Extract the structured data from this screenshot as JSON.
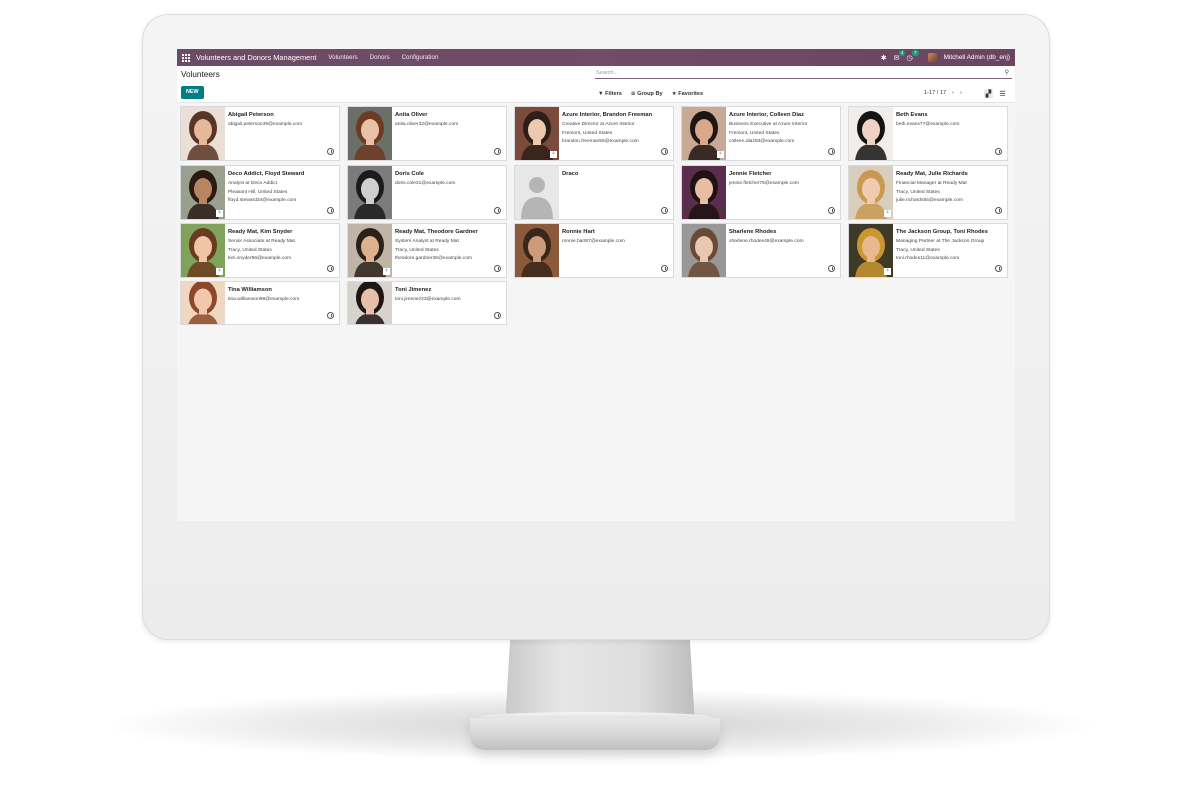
{
  "navbar": {
    "app_title": "Volunteers and Donors Management",
    "menus": [
      "Volunteers",
      "Donors",
      "Configuration"
    ],
    "messages_badge": "4",
    "activities_badge": "7",
    "user": "Mitchell Admin (db_enj)"
  },
  "control_panel": {
    "breadcrumb": "Volunteers",
    "search_placeholder": "Search...",
    "new_label": "NEW",
    "filters_label": "Filters",
    "groupby_label": "Group By",
    "favorites_label": "Favorites",
    "pager": "1-17 / 17"
  },
  "cards": [
    {
      "name": "Abigail Peterson",
      "lines": [
        "abigail.peterson39@example.com"
      ],
      "photo": "woman-curly-brown",
      "company_icon": false
    },
    {
      "name": "Anita Oliver",
      "lines": [
        "anita.oliver32@example.com"
      ],
      "photo": "woman-brown",
      "company_icon": false
    },
    {
      "name": "Azure Interior, Brandon Freeman",
      "lines": [
        "Creative Director at Azure Interior",
        "Fremont, United States",
        "brandon.freeman55@example.com"
      ],
      "photo": "man-young",
      "company_icon": true
    },
    {
      "name": "Azure Interior, Colleen Diaz",
      "lines": [
        "Business Executive at Azure Interior",
        "Fremont, United States",
        "colleen.diaz83@example.com"
      ],
      "photo": "woman-dark",
      "company_icon": true
    },
    {
      "name": "Beth Evans",
      "lines": [
        "beth.evans77@example.com"
      ],
      "photo": "woman-hat",
      "company_icon": false
    },
    {
      "name": "Deco Addict, Floyd Steward",
      "lines": [
        "Analyst at Deco Addict",
        "Pleasant Hill, United States",
        "floyd.steward34@example.com"
      ],
      "photo": "man-smile",
      "company_icon": true
    },
    {
      "name": "Doris Cole",
      "lines": [
        "doris.cole31@example.com"
      ],
      "photo": "woman-bw",
      "company_icon": false
    },
    {
      "name": "Draco",
      "lines": [],
      "photo": "placeholder",
      "company_icon": false
    },
    {
      "name": "Jennie Fletcher",
      "lines": [
        "jennie.fletcher76@example.com"
      ],
      "photo": "woman-dark-hair",
      "company_icon": false
    },
    {
      "name": "Ready Mat, Julie Richards",
      "lines": [
        "Financial Manager at Ready Mat",
        "Tracy, United States",
        "julie.richards84@example.com"
      ],
      "photo": "woman-blonde",
      "company_icon": true
    },
    {
      "name": "Ready Mat, Kim Snyder",
      "lines": [
        "Senior Associate at Ready Mat",
        "Tracy, United States",
        "kim.snyder96@example.com"
      ],
      "photo": "woman-green",
      "company_icon": true
    },
    {
      "name": "Ready Mat, Theodore Gardner",
      "lines": [
        "System Analyst at Ready Mat",
        "Tracy, United States",
        "theodore.gardner36@example.com"
      ],
      "photo": "man-beard",
      "company_icon": true
    },
    {
      "name": "Ronnie Hart",
      "lines": [
        "ronnie.hart87@example.com"
      ],
      "photo": "man-brick",
      "company_icon": false
    },
    {
      "name": "Sharlene Rhodes",
      "lines": [
        "sharlene.rhodes49@example.com"
      ],
      "photo": "woman-grey",
      "company_icon": false
    },
    {
      "name": "The Jackson Group, Toni Rhodes",
      "lines": [
        "Managing Partner at The Jackson Group",
        "Tracy, United States",
        "toni.rhodes11@example.com"
      ],
      "photo": "woman-golden",
      "company_icon": true
    },
    {
      "name": "Tina Williamson",
      "lines": [
        "tina.williamson98@example.com"
      ],
      "photo": "woman-peach",
      "company_icon": false
    },
    {
      "name": "Toni Jimenez",
      "lines": [
        "toni.jimenez23@example.com"
      ],
      "photo": "woman-thinking",
      "company_icon": false
    }
  ],
  "colors": {
    "navbar": "#714b67",
    "primary_button": "#017e84",
    "badge": "#1b9c85"
  }
}
